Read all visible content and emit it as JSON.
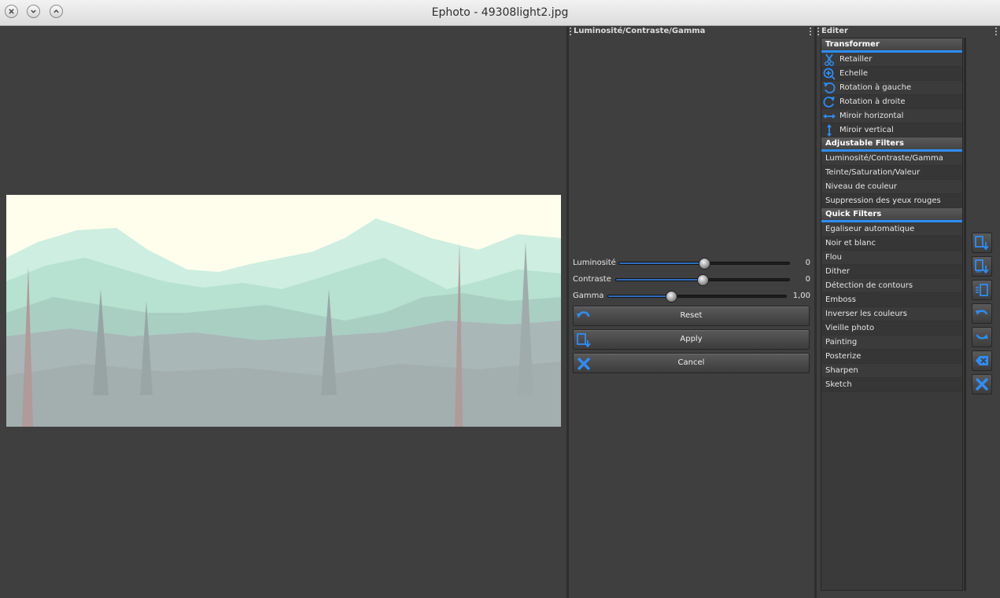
{
  "window": {
    "title": "Ephoto - 49308light2.jpg"
  },
  "adjust_panel": {
    "title": "Luminosité/Contraste/Gamma",
    "sliders": [
      {
        "label": "Luminosité",
        "value": "0",
        "position": 0.5
      },
      {
        "label": "Contraste",
        "value": "0",
        "position": 0.5
      },
      {
        "label": "Gamma",
        "value": "1,00",
        "position": 0.35
      }
    ],
    "buttons": {
      "reset": "Reset",
      "apply": "Apply",
      "cancel": "Cancel"
    }
  },
  "editor_panel": {
    "title": "Editer",
    "groups": {
      "transformer": {
        "title": "Transformer",
        "items": [
          "Retailler",
          "Echelle",
          "Rotation à gauche",
          "Rotation à droite",
          "Miroir horizontal",
          "Miroir vertical"
        ],
        "icons": [
          "scissors-icon",
          "zoom-in-icon",
          "rotate-left-icon",
          "rotate-right-icon",
          "flip-horizontal-icon",
          "flip-vertical-icon"
        ]
      },
      "adjustable": {
        "title": "Adjustable Filters",
        "items": [
          "Luminosité/Contraste/Gamma",
          "Teinte/Saturation/Valeur",
          "Niveau de couleur",
          "Suppression des yeux rouges"
        ]
      },
      "quick": {
        "title": "Quick Filters",
        "items": [
          "Egaliseur automatique",
          "Noir et blanc",
          "Flou",
          "Dither",
          "Détection de contours",
          "Emboss",
          "Inverser les couleurs",
          "Vieille photo",
          "Painting",
          "Posterize",
          "Sharpen",
          "Sketch"
        ]
      }
    }
  },
  "toolbar": {
    "icons": [
      "save-icon",
      "save-as-icon",
      "upload-icon",
      "undo-icon",
      "redo-icon",
      "delete-icon",
      "close-icon"
    ]
  },
  "colors": {
    "accent": "#2e8df5",
    "background": "#3f3f3f",
    "sky": "#fffeec",
    "mountain": "#bfe9d8",
    "forest": "#a9b7b7"
  }
}
